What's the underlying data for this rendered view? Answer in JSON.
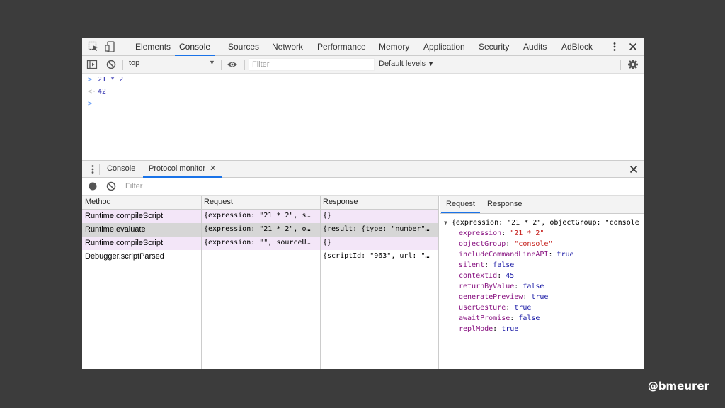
{
  "main_tabs": [
    "Elements",
    "Console",
    "Sources",
    "Network",
    "Performance",
    "Memory",
    "Application",
    "Security",
    "Audits",
    "AdBlock"
  ],
  "active_main_tab": "Console",
  "console_toolbar": {
    "context": "top",
    "filter_placeholder": "Filter",
    "levels": "Default levels"
  },
  "console_lines": [
    {
      "prompt": ">",
      "text": "21 * 2"
    },
    {
      "prompt": "<·",
      "text": "42"
    },
    {
      "prompt": ">",
      "text": ""
    }
  ],
  "drawer": {
    "tabs": [
      "Console",
      "Protocol monitor"
    ],
    "active_tab": "Protocol monitor",
    "filter_placeholder": "Filter"
  },
  "grid": {
    "headers": [
      "Method",
      "Request",
      "Response"
    ],
    "rows": [
      {
        "method": "Runtime.compileScript",
        "request": "{expression: \"21 * 2\", s…",
        "response": "{}",
        "state": "highlight"
      },
      {
        "method": "Runtime.evaluate",
        "request": "{expression: \"21 * 2\", o…",
        "response": "{result: {type: \"number\"…",
        "state": "selected"
      },
      {
        "method": "Runtime.compileScript",
        "request": "{expression: \"\", sourceU…",
        "response": "{}",
        "state": "highlight"
      },
      {
        "method": "Debugger.scriptParsed",
        "request": "",
        "response": "{scriptId: \"963\", url: \"…",
        "state": "normal"
      }
    ]
  },
  "details": {
    "tabs": [
      "Request",
      "Response"
    ],
    "active_tab": "Request",
    "summary": "{expression: \"21 * 2\", objectGroup: \"console",
    "props": [
      {
        "key": "expression",
        "value": "\"21 * 2\"",
        "kind": "s"
      },
      {
        "key": "objectGroup",
        "value": "\"console\"",
        "kind": "s"
      },
      {
        "key": "includeCommandLineAPI",
        "value": "true",
        "kind": "b"
      },
      {
        "key": "silent",
        "value": "false",
        "kind": "b"
      },
      {
        "key": "contextId",
        "value": "45",
        "kind": "n"
      },
      {
        "key": "returnByValue",
        "value": "false",
        "kind": "b"
      },
      {
        "key": "generatePreview",
        "value": "true",
        "kind": "b"
      },
      {
        "key": "userGesture",
        "value": "true",
        "kind": "b"
      },
      {
        "key": "awaitPromise",
        "value": "false",
        "kind": "b"
      },
      {
        "key": "replMode",
        "value": "true",
        "kind": "b"
      }
    ]
  },
  "handle": "@bmeurer",
  "colors": {
    "highlight_row": "#f3e6f8",
    "selected_row": "#d6d6d6",
    "accent": "#1a73e8"
  }
}
